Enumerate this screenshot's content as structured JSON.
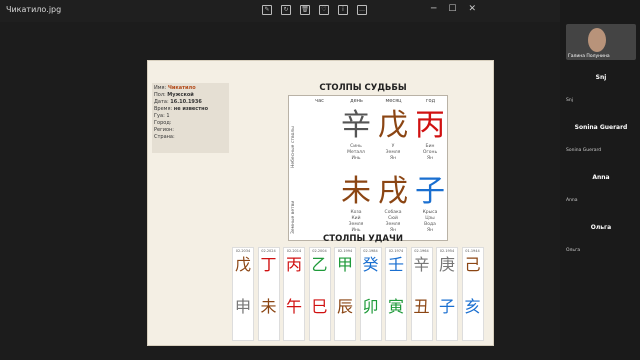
{
  "window": {
    "title": "Чикатило.jpg"
  },
  "chart_info": {
    "name_label": "Имя:",
    "name": "Чикатило",
    "sex_label": "Пол:",
    "sex": "Мужской",
    "date_label": "Дата:",
    "date": "16.10.1936",
    "time_label": "Время:",
    "time": "не известно",
    "gua_label": "Гуа:",
    "gua": "1",
    "city_label": "Город:",
    "region_label": "Регион:",
    "country_label": "Страна:"
  },
  "pillars": {
    "title": "СТОЛПЫ СУДЬБЫ",
    "headers": [
      "час",
      "день",
      "месяц",
      "год"
    ],
    "row_labels": [
      "Небесные стволы",
      "Земные ветви"
    ],
    "stems": [
      {
        "char": "辛",
        "lines": [
          "Синь",
          "Металл",
          "Инь"
        ],
        "color": "#555555"
      },
      {
        "char": "戊",
        "lines": [
          "У",
          "Земля",
          "Ян"
        ],
        "color": "#8b4513"
      },
      {
        "char": "丙",
        "lines": [
          "Бин",
          "Огонь",
          "Ян"
        ],
        "color": "#d01010"
      }
    ],
    "branches": [
      {
        "char": "未",
        "lines": [
          "Коза",
          "Кий",
          "Земля",
          "Инь"
        ],
        "color": "#8b4513"
      },
      {
        "char": "戌",
        "lines": [
          "Собака",
          "Сюй",
          "Земля",
          "Ян"
        ],
        "color": "#8b4513"
      },
      {
        "char": "子",
        "lines": [
          "Крыса",
          "Цзы",
          "Вода",
          "Ян"
        ],
        "color": "#1a6fd0"
      }
    ]
  },
  "luck": {
    "title": "СТОЛПЫ УДАЧИ",
    "columns": [
      {
        "date": "02.2034",
        "top": "戊",
        "tc": "#8b4513",
        "bot": "申",
        "bc": "#777777"
      },
      {
        "date": "02.2024",
        "top": "丁",
        "tc": "#d01010",
        "bot": "未",
        "bc": "#8b4513"
      },
      {
        "date": "02.2014",
        "top": "丙",
        "tc": "#d01010",
        "bot": "午",
        "bc": "#d01010"
      },
      {
        "date": "02.2004",
        "top": "乙",
        "tc": "#1f9a3a",
        "bot": "巳",
        "bc": "#d01010"
      },
      {
        "date": "02.1994",
        "top": "甲",
        "tc": "#1f9a3a",
        "bot": "辰",
        "bc": "#8b4513"
      },
      {
        "date": "02.1984",
        "top": "癸",
        "tc": "#1a6fd0",
        "bot": "卯",
        "bc": "#1f9a3a"
      },
      {
        "date": "02.1974",
        "top": "壬",
        "tc": "#1a6fd0",
        "bot": "寅",
        "bc": "#1f9a3a"
      },
      {
        "date": "02.1964",
        "top": "辛",
        "tc": "#777777",
        "bot": "丑",
        "bc": "#8b4513"
      },
      {
        "date": "02.1954",
        "top": "庚",
        "tc": "#777777",
        "bot": "子",
        "bc": "#1a6fd0"
      },
      {
        "date": "01.1944",
        "top": "己",
        "tc": "#8b4513",
        "bot": "亥",
        "bc": "#1a6fd0"
      }
    ]
  },
  "participants": {
    "main": "Галина Полунина",
    "list": [
      {
        "name": "Snj",
        "label": "Snj"
      },
      {
        "name": "Sonina Guerard",
        "label": "Sonina Guerard"
      },
      {
        "name": "Anna",
        "label": "Anna"
      },
      {
        "name": "Ольга",
        "label": "Ольга"
      }
    ]
  }
}
